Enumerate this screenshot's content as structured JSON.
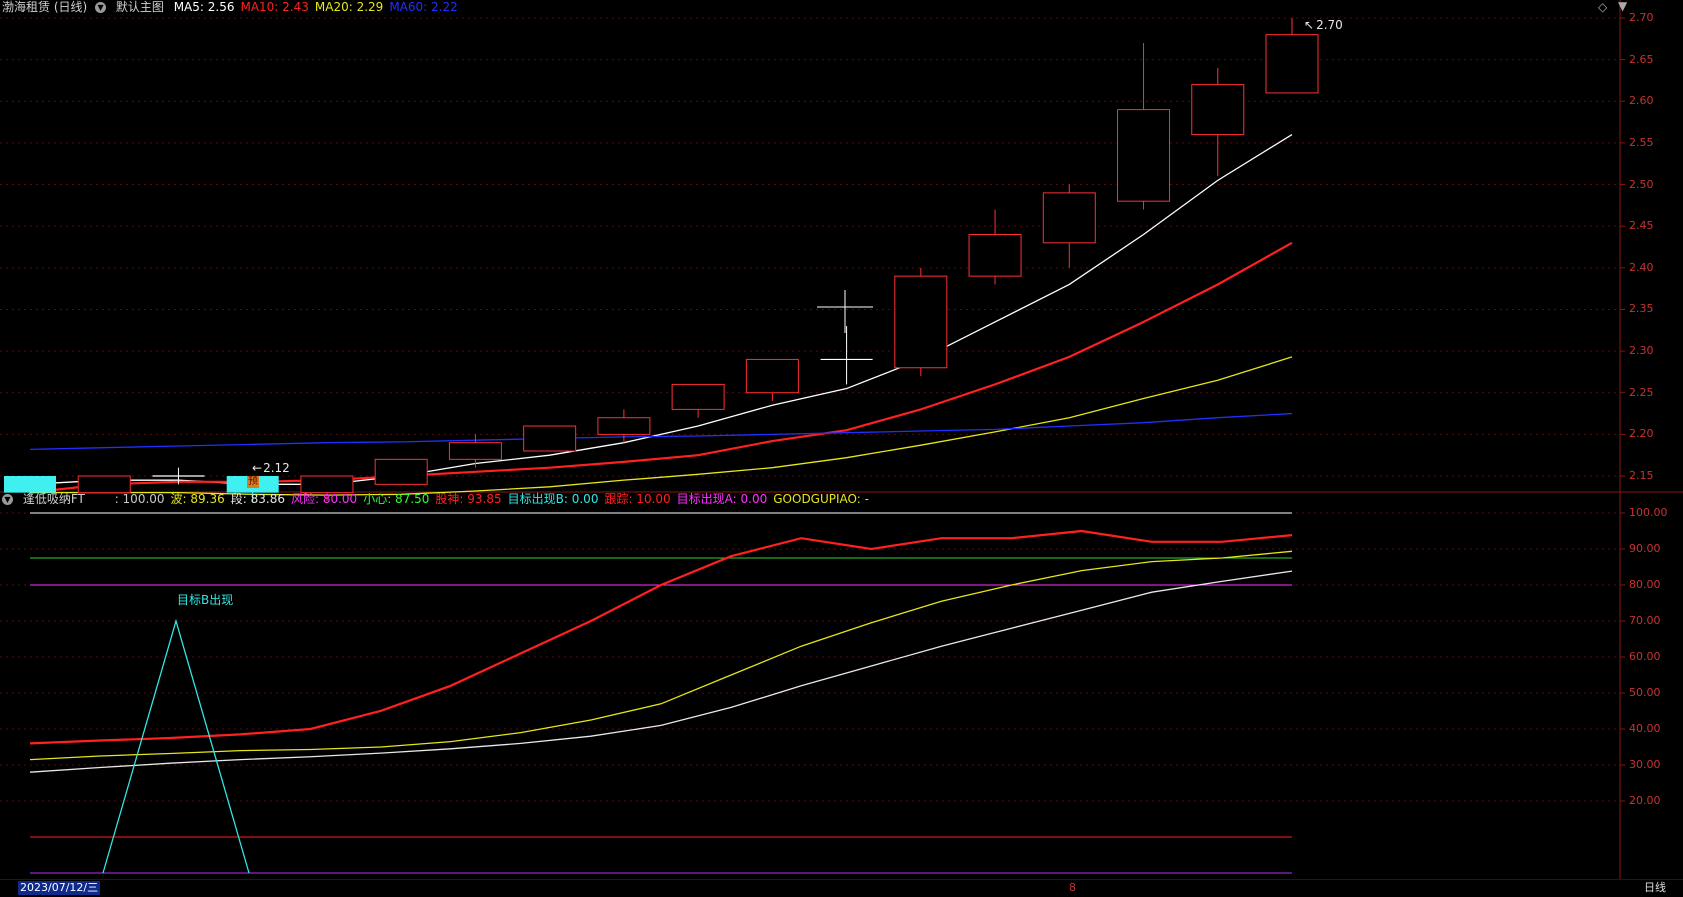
{
  "main_panel": {
    "title": "渤海租赁 (日线)",
    "template": "默认主图",
    "ma_items": [
      {
        "label": "MA5: 2.56",
        "color": "#ffffff"
      },
      {
        "label": "MA10: 2.43",
        "color": "#ff2020"
      },
      {
        "label": "MA20: 2.29",
        "color": "#e6e619"
      },
      {
        "label": "MA60: 2.22",
        "color": "#2030ff"
      }
    ],
    "price_high_label": "2.70",
    "price_low_label": "2.12",
    "pre_badge": "预",
    "y_ticks": [
      "2.70",
      "2.65",
      "2.60",
      "2.55",
      "2.50",
      "2.45",
      "2.40",
      "2.35",
      "2.30",
      "2.25",
      "2.20",
      "2.15"
    ]
  },
  "sub_panel": {
    "title": "逢低吸纳FT",
    "items": [
      {
        "label": ": 100.00",
        "color": "#c8c8c8"
      },
      {
        "label": "波: 89.36",
        "color": "#e6e619"
      },
      {
        "label": "段: 83.86",
        "color": "#e8e8e8"
      },
      {
        "label": "风险: 80.00",
        "color": "#ff30ff"
      },
      {
        "label": "小心: 87.50",
        "color": "#30ff30"
      },
      {
        "label": "股神: 93.85",
        "color": "#ff2020"
      },
      {
        "label": "目标出现B: 0.00",
        "color": "#30e6e6"
      },
      {
        "label": "跟踪: 10.00",
        "color": "#ff2020"
      },
      {
        "label": "目标出现A: 0.00",
        "color": "#ff30ff"
      },
      {
        "label": "GOODGUPIAO: -",
        "color": "#e6e619"
      }
    ],
    "annotation": "目标B出现",
    "y_ticks": [
      "100.00",
      "90.00",
      "80.00",
      "70.00",
      "60.00",
      "50.00",
      "40.00",
      "30.00",
      "20.00"
    ]
  },
  "footer": {
    "date": "2023/07/12/三",
    "period": "日线",
    "marker": "8"
  },
  "chart_data": [
    {
      "type": "candlestick",
      "ylim": [
        2.1,
        2.72
      ],
      "candles": [
        {
          "o": 2.15,
          "c": 2.13,
          "h": 2.15,
          "l": 2.13,
          "color": "cyan"
        },
        {
          "o": 2.13,
          "c": 2.15,
          "h": 2.15,
          "l": 2.13,
          "color": "red"
        },
        {
          "o": 2.15,
          "c": 2.15,
          "h": 2.16,
          "l": 2.14,
          "color": "white"
        },
        {
          "o": 2.15,
          "c": 2.13,
          "h": 2.15,
          "l": 2.12,
          "color": "cyan"
        },
        {
          "o": 2.13,
          "c": 2.15,
          "h": 2.15,
          "l": 2.12,
          "color": "red"
        },
        {
          "o": 2.14,
          "c": 2.17,
          "h": 2.17,
          "l": 2.14,
          "color": "red"
        },
        {
          "o": 2.17,
          "c": 2.19,
          "h": 2.2,
          "l": 2.16,
          "color": "red"
        },
        {
          "o": 2.18,
          "c": 2.21,
          "h": 2.21,
          "l": 2.18,
          "color": "red"
        },
        {
          "o": 2.2,
          "c": 2.22,
          "h": 2.23,
          "l": 2.19,
          "color": "red"
        },
        {
          "o": 2.23,
          "c": 2.26,
          "h": 2.26,
          "l": 2.22,
          "color": "red"
        },
        {
          "o": 2.25,
          "c": 2.29,
          "h": 2.29,
          "l": 2.24,
          "color": "red"
        },
        {
          "o": 2.29,
          "c": 2.29,
          "h": 2.33,
          "l": 2.26,
          "color": "white"
        },
        {
          "o": 2.28,
          "c": 2.39,
          "h": 2.4,
          "l": 2.27,
          "color": "red"
        },
        {
          "o": 2.39,
          "c": 2.44,
          "h": 2.47,
          "l": 2.38,
          "color": "red"
        },
        {
          "o": 2.43,
          "c": 2.49,
          "h": 2.5,
          "l": 2.4,
          "color": "red"
        },
        {
          "o": 2.48,
          "c": 2.59,
          "h": 2.67,
          "l": 2.47,
          "color": "red"
        },
        {
          "o": 2.56,
          "c": 2.62,
          "h": 2.64,
          "l": 2.51,
          "color": "red"
        },
        {
          "o": 2.61,
          "c": 2.68,
          "h": 2.7,
          "l": 2.61,
          "color": "red"
        }
      ],
      "series": [
        {
          "name": "MA5",
          "color": "#ffffff",
          "values": [
            2.14,
            2.145,
            2.145,
            2.14,
            2.14,
            2.15,
            2.165,
            2.175,
            2.19,
            2.21,
            2.235,
            2.255,
            2.29,
            2.335,
            2.38,
            2.44,
            2.505,
            2.56
          ]
        },
        {
          "name": "MA10",
          "color": "#ff2020",
          "values": [
            2.13,
            2.14,
            2.143,
            2.143,
            2.145,
            2.15,
            2.155,
            2.16,
            2.167,
            2.175,
            2.192,
            2.205,
            2.23,
            2.26,
            2.293,
            2.335,
            2.38,
            2.43
          ]
        },
        {
          "name": "MA20",
          "color": "#e6e619",
          "values": [
            2.13,
            2.13,
            2.13,
            2.128,
            2.127,
            2.128,
            2.132,
            2.137,
            2.145,
            2.152,
            2.16,
            2.172,
            2.187,
            2.203,
            2.22,
            2.243,
            2.265,
            2.293
          ]
        },
        {
          "name": "MA60",
          "color": "#2030ff",
          "values": [
            2.182,
            2.184,
            2.186,
            2.188,
            2.19,
            2.191,
            2.193,
            2.195,
            2.197,
            2.198,
            2.2,
            2.202,
            2.204,
            2.206,
            2.21,
            2.214,
            2.22,
            2.225
          ]
        }
      ]
    },
    {
      "type": "line",
      "ylim": [
        0,
        102
      ],
      "hlines": [
        {
          "value": 100,
          "color": "#ffffff"
        },
        {
          "value": 87.5,
          "color": "#30d030"
        },
        {
          "value": 80,
          "color": "#ff30ff"
        },
        {
          "value": 10,
          "color": "#ff2020"
        },
        {
          "value": 0,
          "color": "#b030ff"
        }
      ],
      "series": [
        {
          "name": "股神",
          "color": "#ff2020",
          "values": [
            36,
            36.8,
            37.5,
            38.5,
            40,
            45,
            52,
            61,
            70,
            80,
            88,
            93,
            90,
            93,
            93,
            95,
            92,
            92,
            93.85
          ]
        },
        {
          "name": "波",
          "color": "#e6e619",
          "values": [
            31.5,
            32.5,
            33.2,
            34,
            34.3,
            35,
            36.5,
            39,
            42.5,
            47,
            55,
            63,
            69.5,
            75.5,
            80,
            84,
            86.5,
            87.5,
            89.36
          ]
        },
        {
          "name": "段",
          "color": "#e8e8e8",
          "values": [
            28,
            29.3,
            30.5,
            31.5,
            32.3,
            33.3,
            34.5,
            36,
            38,
            41,
            46,
            52,
            57.5,
            63,
            68,
            73,
            78,
            81,
            83.86
          ]
        },
        {
          "name": "目标出现B",
          "color": "#30e6e6",
          "points": [
            [
              1,
              0
            ],
            [
              2,
              70
            ],
            [
              3,
              0
            ]
          ]
        }
      ]
    }
  ]
}
